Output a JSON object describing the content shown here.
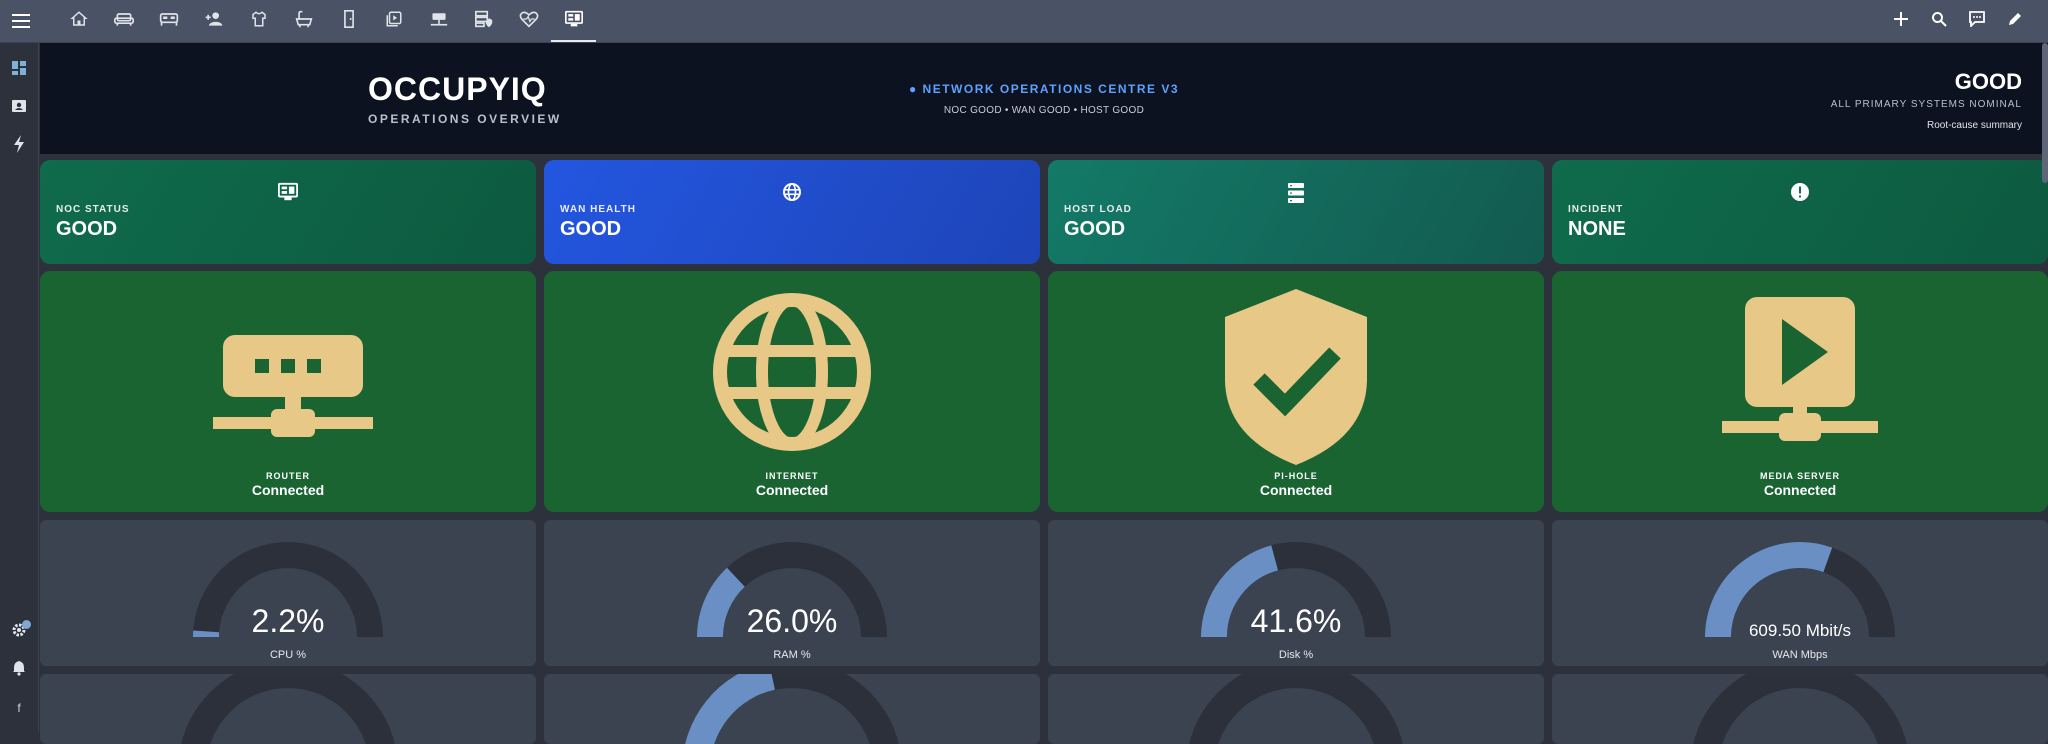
{
  "toolbar": {
    "tabs": [
      {
        "icon": "home-icon",
        "active": false
      },
      {
        "icon": "sofa-icon",
        "active": false
      },
      {
        "icon": "bed-icon",
        "active": false
      },
      {
        "icon": "people-icon",
        "active": false
      },
      {
        "icon": "shirt-icon",
        "active": false
      },
      {
        "icon": "bathtub-icon",
        "active": false
      },
      {
        "icon": "door-icon",
        "active": false
      },
      {
        "icon": "play-box-icon",
        "active": false
      },
      {
        "icon": "network-switch-icon",
        "active": false
      },
      {
        "icon": "server-shield-icon",
        "active": false
      },
      {
        "icon": "heart-pulse-icon",
        "active": false
      },
      {
        "icon": "monitor-dashboard-icon",
        "active": true
      }
    ],
    "actions": [
      "plus-icon",
      "search-icon",
      "chat-icon",
      "pencil-icon"
    ]
  },
  "sidebar": {
    "items": [
      "dashboard-icon",
      "badge-icon",
      "lightning-icon"
    ],
    "bottom": [
      "gear-icon",
      "bell-icon"
    ],
    "user_initial": "f"
  },
  "header": {
    "title": "OCCUPYIQ",
    "subtitle": "OPERATIONS OVERVIEW",
    "center_title": "● NETWORK OPERATIONS CENTRE V3",
    "center_sub": "NOC GOOD • WAN GOOD • HOST GOOD",
    "status": "GOOD",
    "status_sub": "ALL PRIMARY SYSTEMS NOMINAL",
    "status_link": "Root-cause summary"
  },
  "summary": [
    {
      "label": "NOC STATUS",
      "value": "GOOD",
      "icon": "monitor-dashboard-icon",
      "color": "#0f6b4c"
    },
    {
      "label": "WAN HEALTH",
      "value": "GOOD",
      "icon": "globe-icon",
      "color": "#2355d6"
    },
    {
      "label": "HOST LOAD",
      "value": "GOOD",
      "icon": "server-icon",
      "color": "#117765"
    },
    {
      "label": "INCIDENT",
      "value": "NONE",
      "icon": "alert-circle-icon",
      "color": "#0f6b4c"
    }
  ],
  "devices": [
    {
      "name": "ROUTER",
      "state": "Connected",
      "icon": "router-icon"
    },
    {
      "name": "INTERNET",
      "state": "Connected",
      "icon": "globe-icon"
    },
    {
      "name": "PI-HOLE",
      "state": "Connected",
      "icon": "shield-check-icon"
    },
    {
      "name": "MEDIA SERVER",
      "state": "Connected",
      "icon": "play-network-icon"
    }
  ],
  "gauges": [
    {
      "value": "2.2%",
      "label": "CPU %",
      "fraction": 0.022
    },
    {
      "value": "26.0%",
      "label": "RAM %",
      "fraction": 0.26
    },
    {
      "value": "41.6%",
      "label": "Disk %",
      "fraction": 0.416
    },
    {
      "value": "609.50 Mbit/s",
      "label": "WAN Mbps",
      "fraction": 0.61
    }
  ],
  "colors": {
    "gauge_fill": "#6a8fc4",
    "gauge_track": "#2b303a",
    "icon_gold": "#e8c887",
    "device_bg": "#1a6432"
  }
}
